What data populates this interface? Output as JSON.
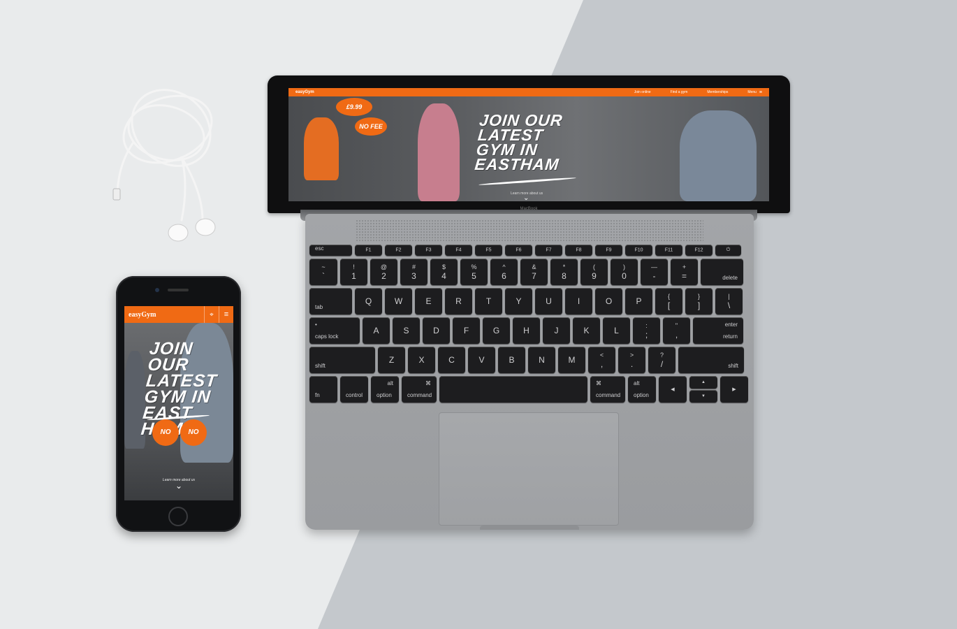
{
  "laptop": {
    "brand": "MacBook",
    "site": {
      "logo": "easyGym",
      "nav": [
        "Join online",
        "Find a gym",
        "Memberships",
        "Menu"
      ],
      "headline_lines": [
        "JOIN OUR",
        "LATEST",
        "GYM IN",
        "EASTHAM"
      ],
      "price_badge": "£9.99",
      "no_fee_badge": "NO FEE",
      "scroll_hint": "Learn more about us"
    },
    "keyboard": {
      "fn_row": [
        "esc",
        "F1",
        "F2",
        "F3",
        "F4",
        "F5",
        "F6",
        "F7",
        "F8",
        "F9",
        "F10",
        "F11",
        "F12",
        "⏻"
      ],
      "num_row": [
        {
          "top": "~",
          "bottom": "`"
        },
        {
          "top": "!",
          "bottom": "1"
        },
        {
          "top": "@",
          "bottom": "2"
        },
        {
          "top": "#",
          "bottom": "3"
        },
        {
          "top": "$",
          "bottom": "4"
        },
        {
          "top": "%",
          "bottom": "5"
        },
        {
          "top": "^",
          "bottom": "6"
        },
        {
          "top": "&",
          "bottom": "7"
        },
        {
          "top": "*",
          "bottom": "8"
        },
        {
          "top": "(",
          "bottom": "9"
        },
        {
          "top": ")",
          "bottom": "0"
        },
        {
          "top": "—",
          "bottom": "-"
        },
        {
          "top": "+",
          "bottom": "="
        }
      ],
      "delete": "delete",
      "tab": "tab",
      "q_row": [
        "Q",
        "W",
        "E",
        "R",
        "T",
        "Y",
        "U",
        "I",
        "O",
        "P"
      ],
      "q_row_sym": [
        {
          "top": "{",
          "bottom": "["
        },
        {
          "top": "}",
          "bottom": "]"
        },
        {
          "top": "|",
          "bottom": "\\"
        }
      ],
      "caps": "caps lock",
      "a_row": [
        "A",
        "S",
        "D",
        "F",
        "G",
        "H",
        "J",
        "K",
        "L"
      ],
      "a_row_sym": [
        {
          "top": ":",
          "bottom": ";"
        },
        {
          "top": "\"",
          "bottom": ","
        }
      ],
      "enter_top": "enter",
      "enter_bottom": "return",
      "shift": "shift",
      "z_row": [
        "Z",
        "X",
        "C",
        "V",
        "B",
        "N",
        "M"
      ],
      "z_row_sym": [
        {
          "top": "<",
          "bottom": ","
        },
        {
          "top": ">",
          "bottom": "."
        },
        {
          "top": "?",
          "bottom": "/"
        }
      ],
      "fn": "fn",
      "control": "control",
      "alt": "alt",
      "option": "option",
      "cmd_symbol": "⌘",
      "command": "command",
      "arrow_left": "◀",
      "arrow_up": "▲",
      "arrow_down": "▼",
      "arrow_right": "▶"
    }
  },
  "phone": {
    "site": {
      "logo": "easyGym",
      "headline_lines": [
        "JOIN OUR",
        "LATEST",
        "GYM IN",
        "EAST HAM"
      ],
      "badge_left": "NO",
      "badge_right": "NO",
      "scroll_hint": "Learn more about us",
      "location_icon": "location-pin-icon",
      "menu_icon": "menu-icon"
    }
  },
  "colors": {
    "brand_orange": "#f06a14",
    "background_light": "#e9ebec",
    "background_shade": "#c3c7cb"
  }
}
